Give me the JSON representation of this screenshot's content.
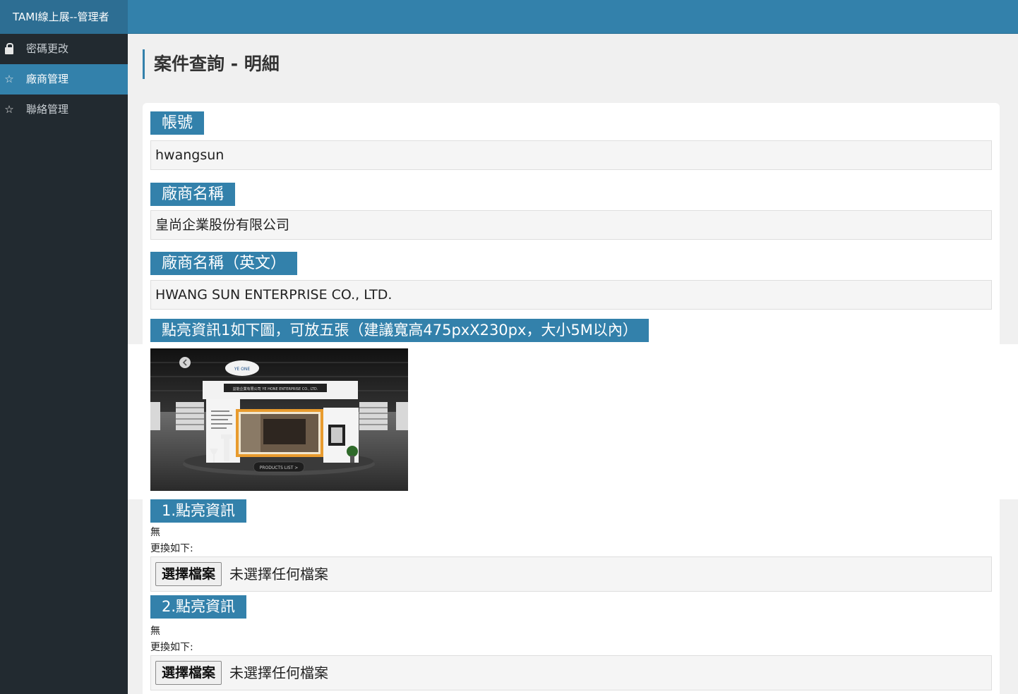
{
  "brand": "TAMI線上展--管理者",
  "sidebar": {
    "items": [
      {
        "label": "密碼更改",
        "icon": "lock-icon"
      },
      {
        "label": "廠商管理",
        "icon": "star-icon",
        "active": true
      },
      {
        "label": "聯絡管理",
        "icon": "star-icon"
      }
    ]
  },
  "page_title": "案件查詢 - 明細",
  "fields": {
    "account": {
      "label": "帳號",
      "value": "hwangsun"
    },
    "company_name": {
      "label": "廠商名稱",
      "value": "皇尚企業股份有限公司"
    },
    "company_name_en": {
      "label": "廠商名稱（英文）",
      "value": "HWANG SUN ENTERPRISE CO., LTD."
    },
    "highlight_info": {
      "label": "點亮資訊1如下圖，可放五張（建議寬高475pxX230px，大小5M以內）"
    }
  },
  "preview": {
    "sign": "益能企業有限公司 YE HONE ENTERPRISE CO., LTD.",
    "logo": "YE ONE",
    "cta": "PRODUCTS LIST >"
  },
  "uploads": [
    {
      "label": "1.點亮資訊",
      "current": "無",
      "replace_label": "更換如下:",
      "button": "選擇檔案",
      "status": "未選擇任何檔案"
    },
    {
      "label": "2.點亮資訊",
      "current": "無",
      "replace_label": "更換如下:",
      "button": "選擇檔案",
      "status": "未選擇任何檔案"
    }
  ],
  "colors": {
    "accent": "#3381ab",
    "sidebar": "#222a30"
  }
}
